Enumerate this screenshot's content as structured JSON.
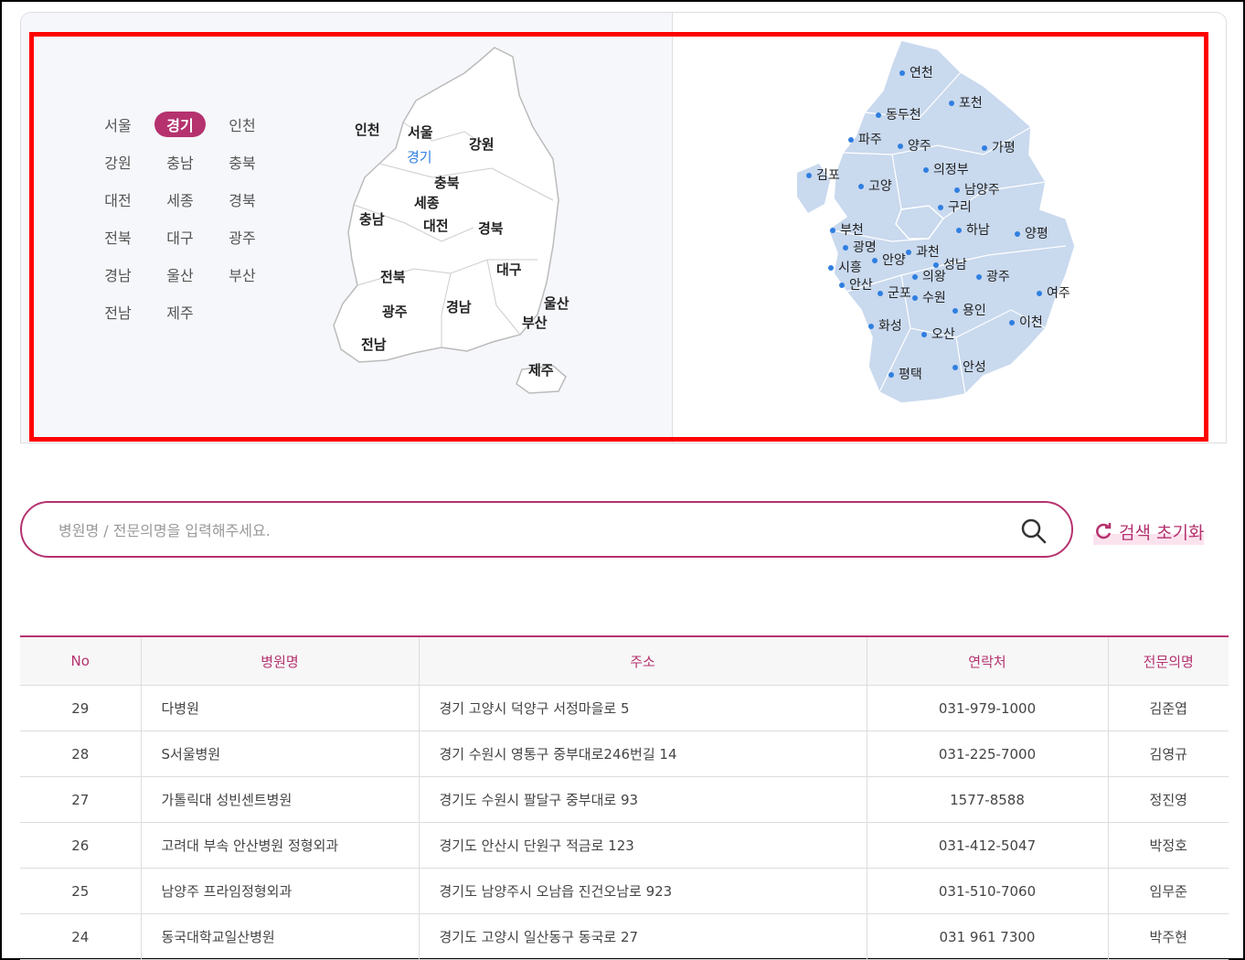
{
  "regions": [
    "서울",
    "경기",
    "인천",
    "강원",
    "충남",
    "충북",
    "대전",
    "세종",
    "경북",
    "전북",
    "대구",
    "광주",
    "경남",
    "울산",
    "부산",
    "전남",
    "제주"
  ],
  "selected_region": "경기",
  "korea_map_labels": [
    "인천",
    "서울",
    "강원",
    "경기",
    "충북",
    "세종",
    "충남",
    "대전",
    "경북",
    "대구",
    "전북",
    "울산",
    "광주",
    "경남",
    "부산",
    "전남",
    "제주"
  ],
  "gyeonggi_map_labels": [
    "연천",
    "포천",
    "동두천",
    "파주",
    "양주",
    "가평",
    "의정부",
    "김포",
    "고양",
    "남양주",
    "구리",
    "부천",
    "하남",
    "양평",
    "광명",
    "과천",
    "안양",
    "시흥",
    "성남",
    "의왕",
    "광주",
    "안산",
    "군포",
    "수원",
    "여주",
    "용인",
    "이천",
    "화성",
    "오산",
    "평택",
    "안성"
  ],
  "colors": {
    "accent": "#b5326f",
    "map_fill": "#c9d9ee",
    "highlight": "#ff0000"
  },
  "search": {
    "placeholder": "병원명 / 전문의명을 입력해주세요.",
    "value": "",
    "icon": "search-icon"
  },
  "reset": {
    "label": "검색 초기화",
    "icon": "refresh-icon"
  },
  "table": {
    "headers": [
      "No",
      "병원명",
      "주소",
      "연락처",
      "전문의명"
    ],
    "rows": [
      [
        "29",
        "다병원",
        "경기 고양시 덕양구 서정마을로 5",
        "031-979-1000",
        "김준엽"
      ],
      [
        "28",
        "S서울병원",
        "경기 수원시 영통구 중부대로246번길 14",
        "031-225-7000",
        "김영규"
      ],
      [
        "27",
        "가톨릭대 성빈센트병원",
        "경기도 수원시 팔달구 중부대로 93",
        "1577-8588",
        "정진영"
      ],
      [
        "26",
        "고려대 부속 안산병원 정형외과",
        "경기도 안산시 단원구 적금로 123",
        "031-412-5047",
        "박정호"
      ],
      [
        "25",
        "남양주 프라임정형외과",
        "경기도 남양주시 오남읍 진건오남로 923",
        "031-510-7060",
        "임무준"
      ],
      [
        "24",
        "동국대학교일산병원",
        "경기도 고양시 일산동구 동국로 27",
        "031 961 7300",
        "박주현"
      ]
    ]
  }
}
